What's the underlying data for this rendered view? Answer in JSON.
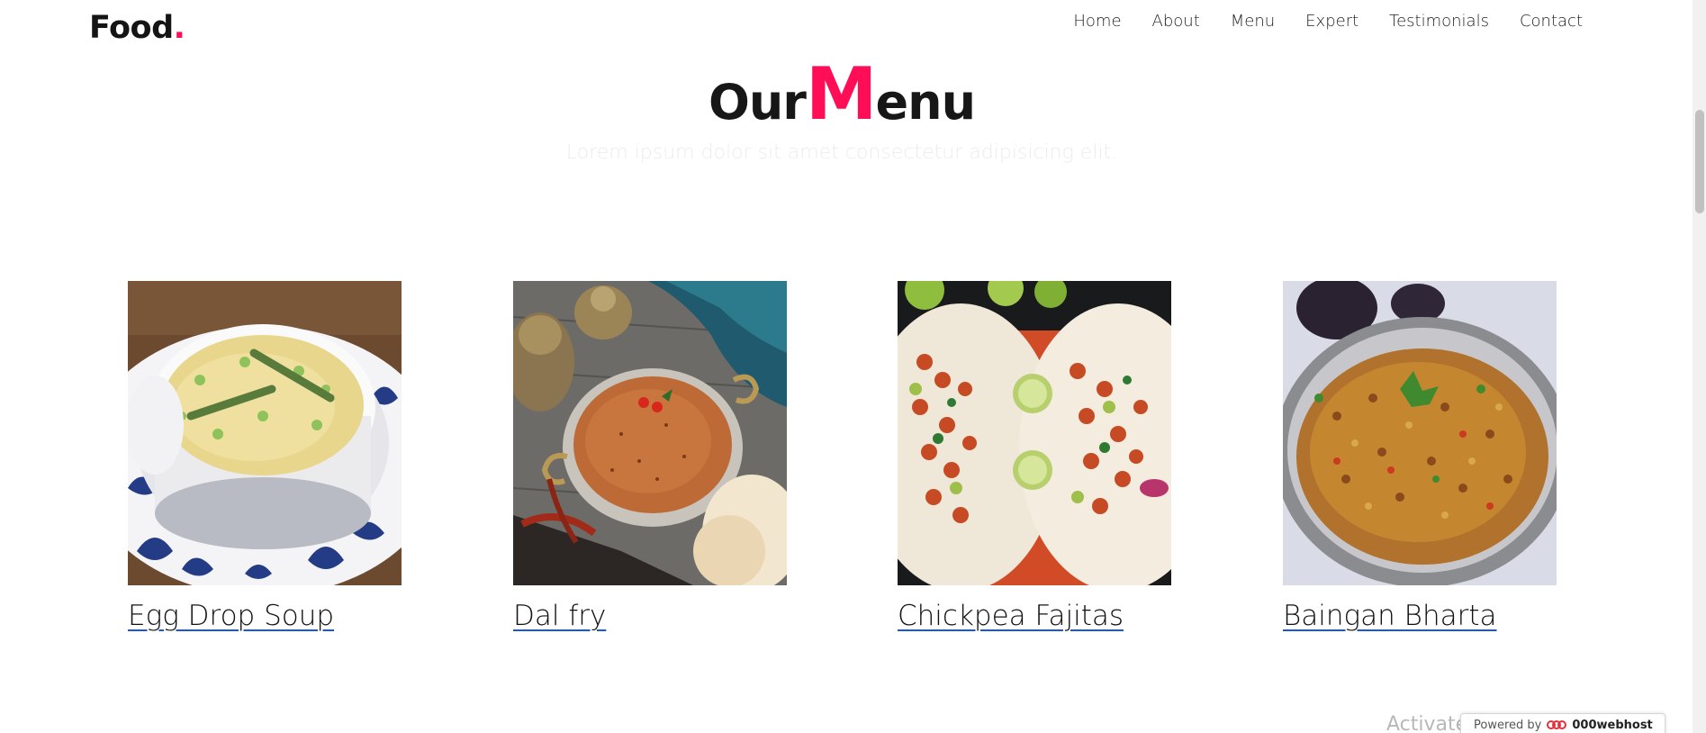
{
  "header": {
    "logo_text": "Food",
    "logo_dot": ".",
    "nav": [
      "Home",
      "About",
      "Menu",
      "Expert",
      "Testimonials",
      "Contact"
    ]
  },
  "section": {
    "title_part1": "Our",
    "title_highlight": "M",
    "title_part2": "enu",
    "subtitle": "Lorem ipsum dolor sit amet consectetur adipisicing elit."
  },
  "menu": {
    "items": [
      {
        "name": "Egg Drop Soup",
        "image_icon": "egg-drop-soup-photo"
      },
      {
        "name": "Dal fry",
        "image_icon": "dal-fry-photo"
      },
      {
        "name": "Chickpea Fajitas",
        "image_icon": "chickpea-fajitas-photo"
      },
      {
        "name": "Baingan Bharta",
        "image_icon": "baingan-bharta-photo"
      }
    ]
  },
  "footer": {
    "watermark": "Activate Window",
    "powered_by": "Powered by",
    "host_name": "000webhost"
  },
  "colors": {
    "accent": "#ff0d57",
    "link_underline": "#1a56db",
    "text": "#111111"
  }
}
